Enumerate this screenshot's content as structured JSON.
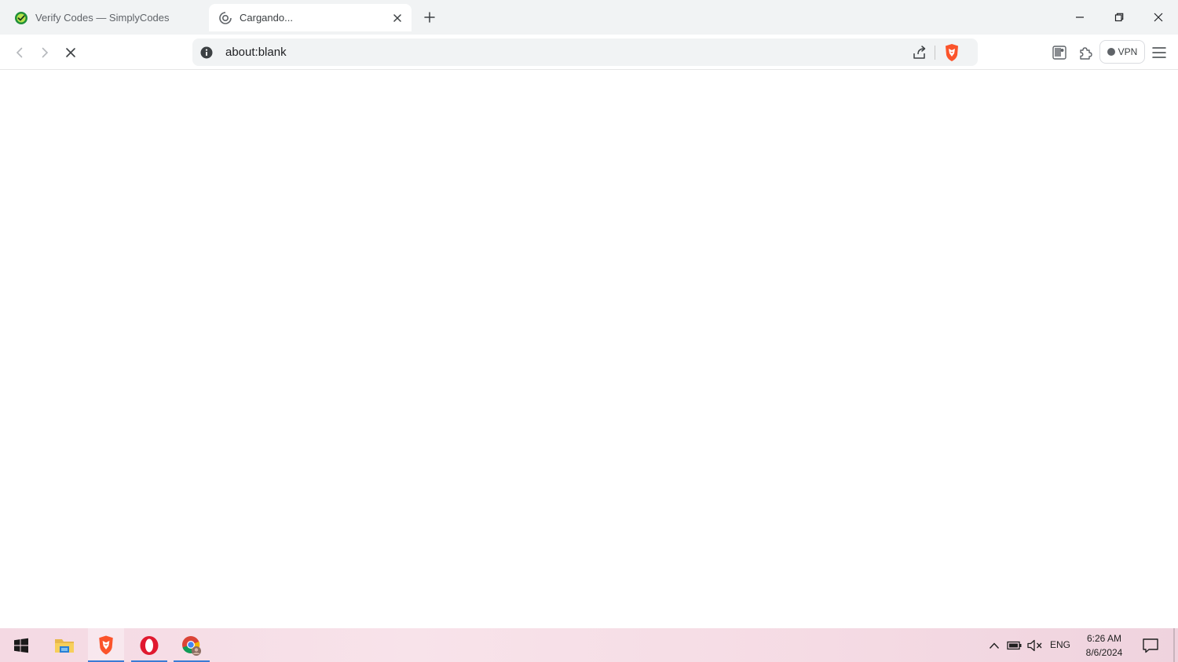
{
  "tabs": [
    {
      "title": "Verify Codes — SimplyCodes",
      "favicon": "simplycodes-favicon",
      "active": false
    },
    {
      "title": "Cargando...",
      "favicon": "loading-spinner-icon",
      "active": true
    }
  ],
  "toolbar": {
    "url": "about:blank",
    "vpn_label": "VPN"
  },
  "taskbar": {
    "apps": [
      "windows-start",
      "file-explorer",
      "brave-browser",
      "opera-browser",
      "chrome-browser"
    ],
    "language": "ENG",
    "time": "6:26 AM",
    "date": "8/6/2024"
  },
  "colors": {
    "tabstrip_bg": "#f1f3f4",
    "brave_orange": "#fb542b",
    "opera_red": "#e0192f",
    "taskbar_bg": "#f6dde6",
    "active_underline": "#3a7bd5"
  }
}
